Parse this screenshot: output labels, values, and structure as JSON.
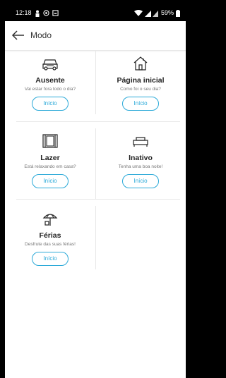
{
  "status": {
    "time": "12:18",
    "battery": "59%"
  },
  "appbar": {
    "title": "Modo"
  },
  "modes": [
    {
      "label": "Ausente",
      "desc": "Vai estar fora todo o dia?",
      "button": "Início",
      "icon": "car-icon"
    },
    {
      "label": "Página inicial",
      "desc": "Como foi o seu dia?",
      "button": "Início",
      "icon": "house-icon"
    },
    {
      "label": "Lazer",
      "desc": "Está relaxando em casa?",
      "button": "Início",
      "icon": "window-icon"
    },
    {
      "label": "Inativo",
      "desc": "Tenha uma boa noite!",
      "button": "Início",
      "icon": "bed-icon"
    },
    {
      "label": "Férias",
      "desc": "Desfrute das suas férias!",
      "button": "Início",
      "icon": "beach-umbrella-icon"
    }
  ],
  "colors": {
    "accent": "#2aa9d8"
  }
}
